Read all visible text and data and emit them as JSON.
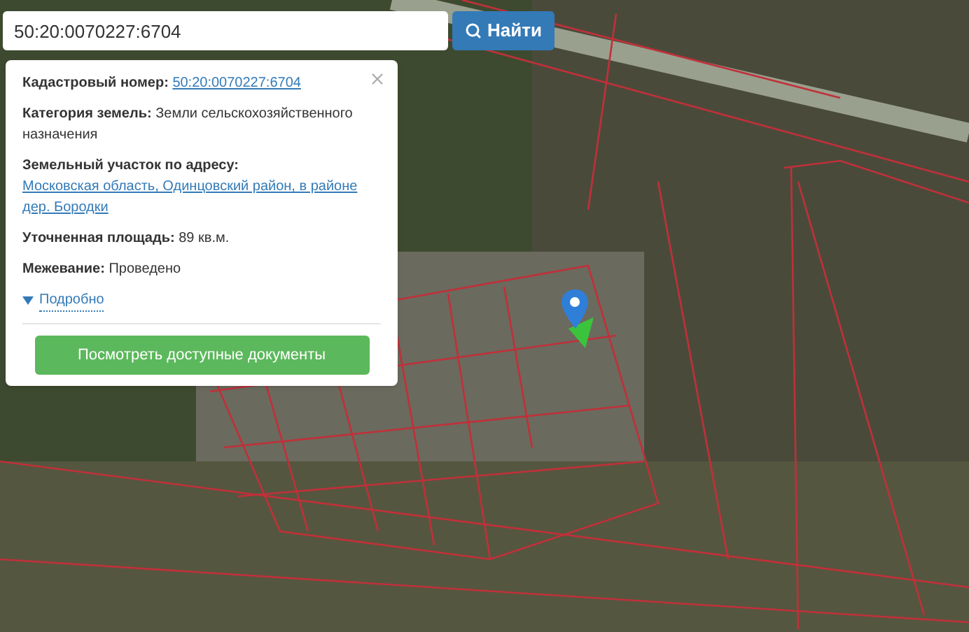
{
  "search": {
    "value": "50:20:0070227:6704",
    "button": "Найти"
  },
  "popup": {
    "rows": [
      {
        "label": "Кадастровый номер:",
        "value": "50:20:0070227:6704",
        "kind": "link"
      },
      {
        "label": "Категория земель:",
        "value": "Земли сельскохозяйственного назначения",
        "kind": "text"
      },
      {
        "label": "Земельный участок по адресу:",
        "value": "Московская область, Одинцовский район, в районе дер. Бородки",
        "kind": "link"
      },
      {
        "label": "Уточненная площадь:",
        "value": "89 кв.м.",
        "kind": "text"
      },
      {
        "label": "Межевание:",
        "value": "Проведено",
        "kind": "text"
      }
    ],
    "details": {
      "label": "Подробно",
      "expanded": false
    },
    "button": "Посмотреть доступные документы"
  }
}
